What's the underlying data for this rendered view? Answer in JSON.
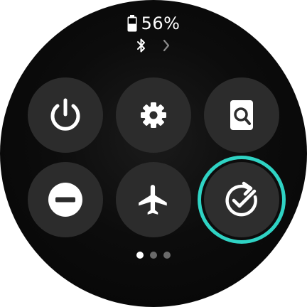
{
  "status": {
    "battery_percent": "56%",
    "battery_level": 0.56,
    "bluetooth_icon": "bluetooth-icon",
    "chevron_icon": "chevron-right-icon"
  },
  "tiles": [
    {
      "name": "power",
      "icon": "power-icon",
      "active": false
    },
    {
      "name": "settings",
      "icon": "gear-icon",
      "active": false
    },
    {
      "name": "find-phone",
      "icon": "find-device-icon",
      "active": false
    },
    {
      "name": "do-not-disturb",
      "icon": "minus-circle-icon",
      "active": false
    },
    {
      "name": "airplane-mode",
      "icon": "airplane-icon",
      "active": false
    },
    {
      "name": "auto-sync",
      "icon": "sync-check-icon",
      "active": true
    }
  ],
  "pager": {
    "pages": 3,
    "current": 1
  },
  "colors": {
    "accent_ring": "#2fd3c4",
    "tile_bg": "#2c2c2c",
    "background": "#000000",
    "icon": "#ffffff"
  }
}
